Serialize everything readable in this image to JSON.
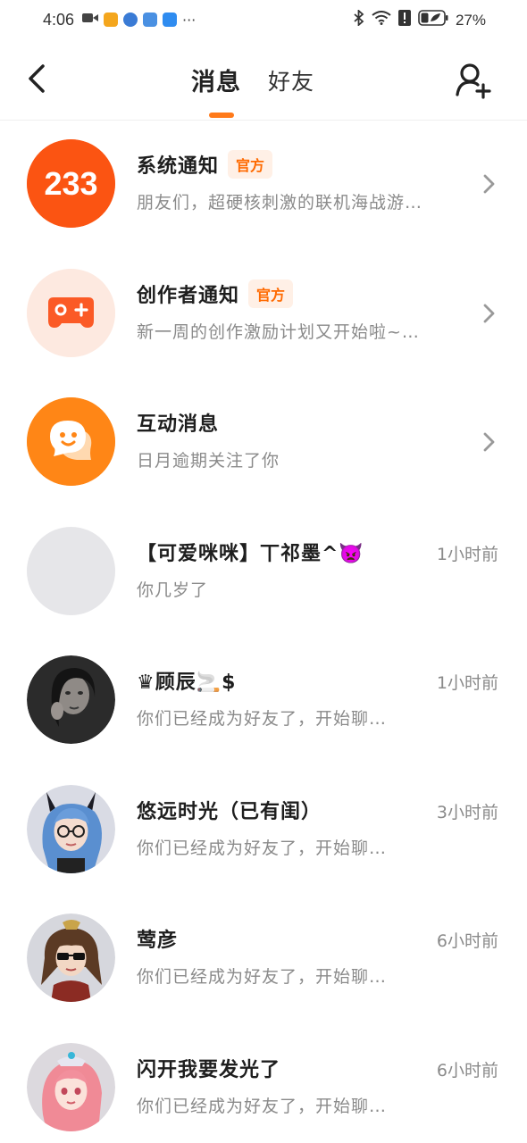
{
  "status_bar": {
    "time": "4:06",
    "left_icons": [
      "video-icon",
      "app-icon",
      "globe-icon",
      "music-icon",
      "cloud-icon",
      "more-dots-icon"
    ],
    "more": "···",
    "right_icons": [
      "bluetooth-icon",
      "wifi-icon",
      "alert-icon",
      "battery-icon"
    ],
    "battery": "27%"
  },
  "header": {
    "tabs": [
      {
        "label": "消息",
        "active": true
      },
      {
        "label": "好友",
        "active": false
      }
    ],
    "accent_color": "#ff7a1a"
  },
  "conversations": [
    {
      "name": "系统通知",
      "badge": "官方",
      "preview": "朋友们，超硬核刺激的联机海战游…",
      "time": "",
      "has_chevron": true,
      "avatar": "233-logo"
    },
    {
      "name": "创作者通知",
      "badge": "官方",
      "preview": "新一周的创作激励计划又开始啦~…",
      "time": "",
      "has_chevron": true,
      "avatar": "gamepad-icon"
    },
    {
      "name": "互动消息",
      "badge": "",
      "preview": "日月逾期关注了你",
      "time": "",
      "has_chevron": true,
      "avatar": "chat-bubble-icon"
    },
    {
      "name": "【可爱咪咪】丅祁墨^👿",
      "badge": "",
      "preview": "你几岁了",
      "time": "1小时前",
      "has_chevron": false,
      "avatar": "blank"
    },
    {
      "name": "♛顾辰🚬$",
      "badge": "",
      "preview": "你们已经成为好友了，开始聊…",
      "time": "1小时前",
      "has_chevron": false,
      "avatar": "photo-dark"
    },
    {
      "name": "悠远时光（已有闺）",
      "badge": "",
      "preview": "你们已经成为好友了，开始聊…",
      "time": "3小时前",
      "has_chevron": false,
      "avatar": "anime-blue-hair"
    },
    {
      "name": "莺彦",
      "badge": "",
      "preview": "你们已经成为好友了，开始聊…",
      "time": "6小时前",
      "has_chevron": false,
      "avatar": "anime-sunglasses"
    },
    {
      "name": "闪开我要发光了",
      "badge": "",
      "preview": "你们已经成为好友了，开始聊…",
      "time": "6小时前",
      "has_chevron": false,
      "avatar": "anime-pink-hair"
    }
  ]
}
